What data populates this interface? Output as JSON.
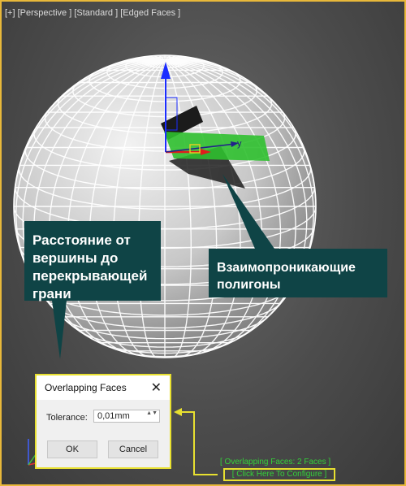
{
  "viewport": {
    "label_plus": "[+]",
    "label_view": "[Perspective ]",
    "label_shading": "[Standard ]",
    "label_edges": "[Edged Faces ]"
  },
  "gizmo": {
    "y_axis": "y"
  },
  "callouts": {
    "distance": [
      "Расстояние от",
      "вершины до",
      "перекрывающей",
      "грани"
    ],
    "intersect": [
      "Взаимопроникающие",
      "полигоны"
    ]
  },
  "dialog": {
    "title": "Overlapping Faces",
    "close_glyph": "✕",
    "tolerance_label": "Tolerance:",
    "tolerance_value": "0,01mm",
    "spinner_glyph": "▲▼",
    "ok_label": "OK",
    "cancel_label": "Cancel"
  },
  "status": {
    "overlap_text": "[ Overlapping Faces: 2 Faces ]",
    "configure_text": "[ Click Here To Configure ]"
  },
  "colors": {
    "viewport_border": "#e8b83a",
    "highlight_border": "#e8e030",
    "callout_bg": "#0f4446",
    "status_green": "#34d23a",
    "selection_green": "#2fc02f"
  }
}
